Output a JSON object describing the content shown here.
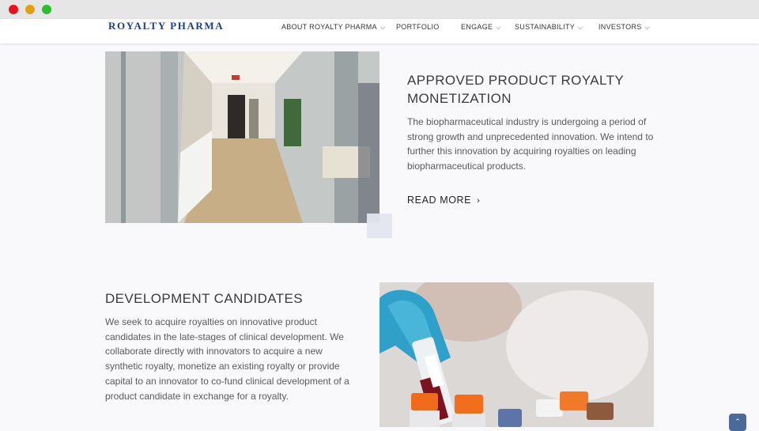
{
  "brand": {
    "logo_text": "ROYALTY PHARMA",
    "logo_color": "#1d3c8f"
  },
  "nav": {
    "items": [
      {
        "label": "ABOUT ROYALTY PHARMA",
        "has_dropdown": true
      },
      {
        "label": "PORTFOLIO",
        "has_dropdown": false
      },
      {
        "label": "ENGAGE",
        "has_dropdown": true
      },
      {
        "label": "SUSTAINABILITY",
        "has_dropdown": true
      },
      {
        "label": "INVESTORS",
        "has_dropdown": true
      }
    ]
  },
  "sections": {
    "approved": {
      "title": "APPROVED PRODUCT ROYALTY MONETIZATION",
      "body": "The biopharmaceutical industry is undergoing a period of strong growth and unprecedented innovation. We intend to further this innovation by acquiring royalties on leading biopharmaceutical products.",
      "read_more": "READ MORE",
      "read_more_icon": "chevron-right-icon",
      "image": "office-interior-photo"
    },
    "development": {
      "title": "DEVELOPMENT CANDIDATES",
      "body": "We seek to acquire royalties on innovative product candidates in the late-stages of clinical development. We collaborate directly with innovators to acquire a new synthetic royalty, monetize an existing royalty or provide capital to an innovator to co-fund clinical development of a product candidate in exchange for a royalty.",
      "image": "lab-test-tubes-photo"
    }
  },
  "scroll_top_icon": "chevron-up-icon",
  "colors": {
    "page_background": "#f9f9fc",
    "header_background": "#ffffff",
    "scroll_button": "#4a6a9a"
  }
}
